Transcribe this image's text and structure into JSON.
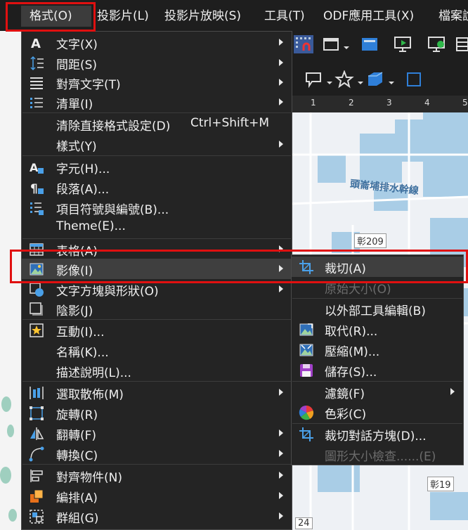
{
  "menubar": {
    "items": [
      {
        "label": "格式(O)",
        "key": "O",
        "active": true
      },
      {
        "label": "投影片(L)",
        "key": "L"
      },
      {
        "label": "投影片放映(S)",
        "key": "S"
      },
      {
        "label": "工具(T)",
        "key": "T"
      },
      {
        "label": "ODF應用工具(X)",
        "key": "X"
      },
      {
        "label": "檔案說"
      }
    ]
  },
  "ruler": {
    "ticks": [
      "1",
      "2",
      "3",
      "4",
      "5"
    ]
  },
  "map": {
    "road_label": "頭崙埔排水幹線",
    "route_labels": [
      "彰209",
      "彰19",
      "24"
    ]
  },
  "format_menu": {
    "items": [
      {
        "label": "文字(X)",
        "icon": "text-icon",
        "submenu": true
      },
      {
        "label": "間距(S)",
        "icon": "spacing-icon",
        "submenu": true
      },
      {
        "label": "對齊文字(T)",
        "icon": "align-text-icon",
        "submenu": true
      },
      {
        "label": "清單(I)",
        "icon": "list-icon",
        "submenu": true
      },
      {
        "label": "清除直接格式設定(D)",
        "shortcut": "Ctrl+Shift+M",
        "icon": ""
      },
      {
        "label": "樣式(Y)",
        "icon": "",
        "submenu": true
      },
      {
        "label": "字元(H)...",
        "icon": "character-icon"
      },
      {
        "label": "段落(A)...",
        "icon": "paragraph-icon"
      },
      {
        "label": "項目符號與編號(B)...",
        "icon": "bullets-icon"
      },
      {
        "label": "Theme(E)...",
        "icon": ""
      },
      {
        "label": "表格(A)",
        "icon": "table-icon",
        "submenu": true
      },
      {
        "label": "影像(I)",
        "icon": "image-icon",
        "submenu": true,
        "highlighted": true
      },
      {
        "label": "文字方塊與形狀(O)",
        "icon": "shape-icon",
        "submenu": true
      },
      {
        "label": "陰影(J)",
        "icon": "shadow-icon"
      },
      {
        "label": "互動(I)...",
        "icon": "interaction-icon"
      },
      {
        "label": "名稱(K)...",
        "icon": ""
      },
      {
        "label": "描述說明(L)...",
        "icon": ""
      },
      {
        "label": "選取散佈(M)",
        "icon": "distribute-icon",
        "submenu": true
      },
      {
        "label": "旋轉(R)",
        "icon": "rotate-icon"
      },
      {
        "label": "翻轉(F)",
        "icon": "flip-icon",
        "submenu": true
      },
      {
        "label": "轉換(C)",
        "icon": "convert-icon",
        "submenu": true
      },
      {
        "label": "對齊物件(N)",
        "icon": "align-objects-icon",
        "submenu": true
      },
      {
        "label": "編排(A)",
        "icon": "arrange-icon",
        "submenu": true
      },
      {
        "label": "群組(G)",
        "icon": "group-icon",
        "submenu": true
      }
    ]
  },
  "image_submenu": {
    "items": [
      {
        "label": "裁切(A)",
        "icon": "crop-icon",
        "highlighted": true
      },
      {
        "label": "原始大小(O)",
        "icon": "",
        "disabled": true
      },
      {
        "label": "以外部工具編輯(B)",
        "icon": ""
      },
      {
        "label": "取代(R)...",
        "icon": "replace-image-icon"
      },
      {
        "label": "壓縮(M)...",
        "icon": "compress-image-icon"
      },
      {
        "label": "儲存(S)...",
        "icon": "save-icon"
      },
      {
        "label": "濾鏡(F)",
        "icon": "",
        "submenu": true
      },
      {
        "label": "色彩(C)",
        "icon": "color-wheel-icon"
      },
      {
        "label": "裁切對話方塊(D)...",
        "icon": "crop-dialog-icon"
      },
      {
        "label": "圖形大小檢查......(E)",
        "icon": "",
        "disabled": true
      }
    ]
  },
  "colors": {
    "menu_bg": "#242424",
    "highlight": "#3f3f3f",
    "annotation_red": "#e01010",
    "accent_blue": "#2f7fd8"
  }
}
